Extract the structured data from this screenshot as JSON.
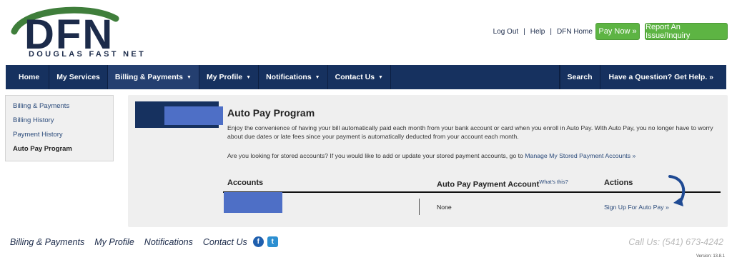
{
  "logo": {
    "text": "DFN",
    "tagline": "DOUGLAS FAST NET"
  },
  "top_links": [
    "Log Out",
    "Help",
    "DFN Home"
  ],
  "buttons": {
    "pay_now": "Pay Now »",
    "report": "Report An Issue/Inquiry"
  },
  "nav": {
    "home": "Home",
    "services": "My Services",
    "billing": "Billing & Payments",
    "profile": "My Profile",
    "notifications": "Notifications",
    "contact": "Contact Us",
    "search": "Search",
    "help": "Have a Question? Get Help. »"
  },
  "sidebar": {
    "items": [
      "Billing & Payments",
      "Billing History",
      "Payment History",
      "Auto Pay Program"
    ]
  },
  "main": {
    "title": "Auto Pay Program",
    "description": "Enjoy the convenience of having your bill automatically paid each month from your bank account or card when you enroll in Auto Pay. With Auto Pay, you no longer have to worry about due dates or late fees since your payment is automatically deducted from your account each month.",
    "stored_prefix": "Are you looking for stored accounts? If you would like to add or update your stored payment accounts, go to",
    "stored_link": "Manage My Stored Payment Accounts »",
    "table": {
      "col_accounts": "Accounts",
      "col_autopay": "Auto Pay Payment Account",
      "whats_this": "What's this?",
      "col_actions": "Actions",
      "row": {
        "autopay_value": "None",
        "action": "Sign Up For Auto Pay »"
      }
    }
  },
  "footer": {
    "links": [
      "Billing & Payments",
      "My Profile",
      "Notifications",
      "Contact Us"
    ],
    "call": "Call Us: (541) 673-4242",
    "version": "Version: 13.8.1"
  },
  "colors": {
    "navy": "#16315f",
    "green": "#5db443",
    "link": "#2a4a7a",
    "redaction": "#4e6fc6"
  },
  "icons": {
    "facebook": "facebook-icon",
    "twitter": "twitter-icon",
    "arrow": "curved-arrow-icon"
  }
}
